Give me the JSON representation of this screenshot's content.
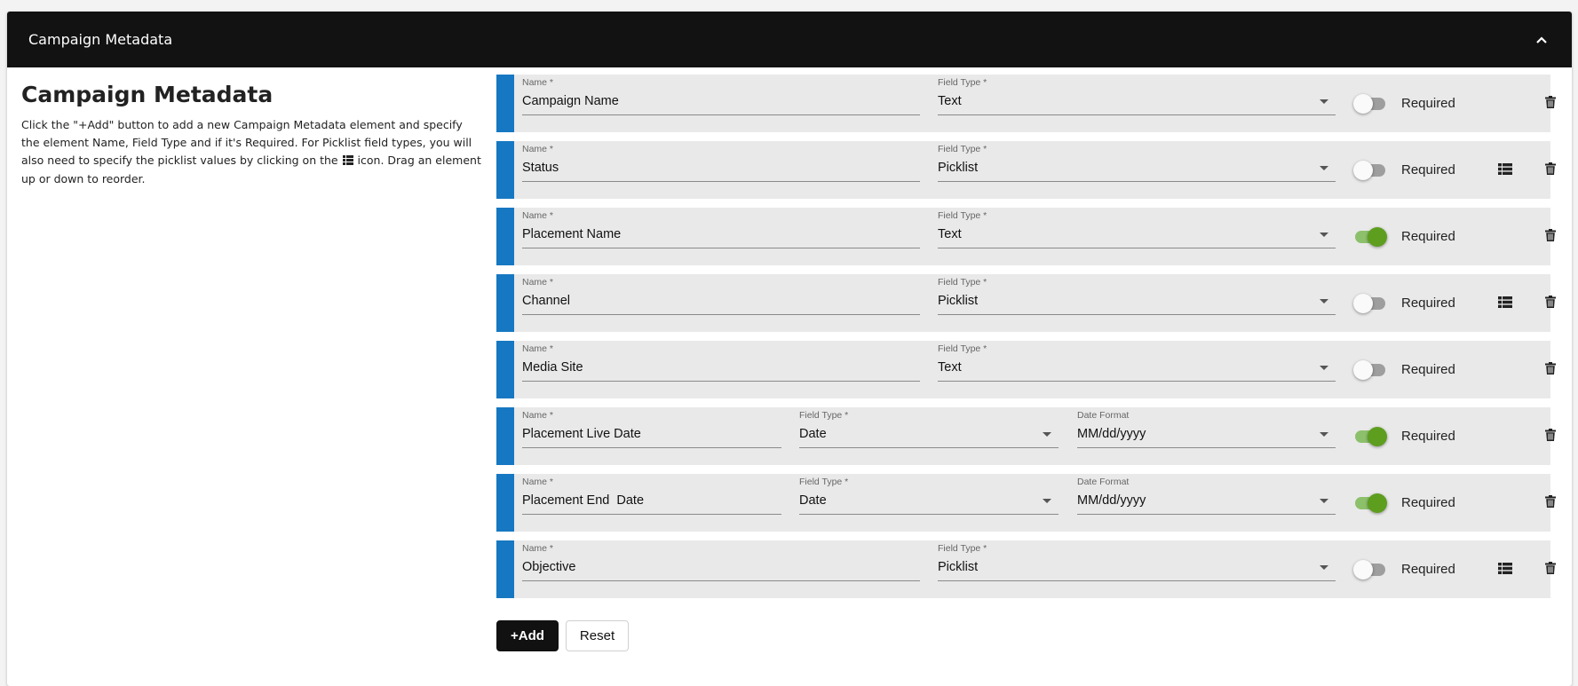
{
  "panel": {
    "header_title": "Campaign Metadata"
  },
  "intro": {
    "title": "Campaign Metadata",
    "desc_part1": "Click the \"+Add\" button to add a new Campaign Metadata element and specify the element Name, Field Type and if it's Required. For Picklist field types, you will also need to specify the picklist values by clicking on the ",
    "desc_part2": " icon. Drag an element up or down to reorder."
  },
  "labels": {
    "name": "Name *",
    "field_type": "Field Type *",
    "date_format": "Date Format",
    "required": "Required"
  },
  "rows": [
    {
      "name": "Campaign Name",
      "field_type": "Text",
      "required": false
    },
    {
      "name": "Status",
      "field_type": "Picklist",
      "required": false
    },
    {
      "name": "Placement Name",
      "field_type": "Text",
      "required": true
    },
    {
      "name": "Channel",
      "field_type": "Picklist",
      "required": false
    },
    {
      "name": "Media Site",
      "field_type": "Text",
      "required": false
    },
    {
      "name": "Placement Live Date",
      "field_type": "Date",
      "date_format": "MM/dd/yyyy",
      "required": true
    },
    {
      "name": "Placement End  Date",
      "field_type": "Date",
      "date_format": "MM/dd/yyyy",
      "required": true
    },
    {
      "name": "Objective",
      "field_type": "Picklist",
      "required": false
    }
  ],
  "actions": {
    "add_label": "+Add",
    "reset_label": "Reset"
  },
  "colors": {
    "header_bg": "#121212",
    "row_accent": "#1678c2",
    "row_bg": "#e9e9e9",
    "toggle_on": "#5d9e1e",
    "toggle_off": "#9e9e9e"
  },
  "icons": {
    "collapse": "chevron-up-icon",
    "picklist": "list-icon",
    "delete": "trash-icon"
  }
}
